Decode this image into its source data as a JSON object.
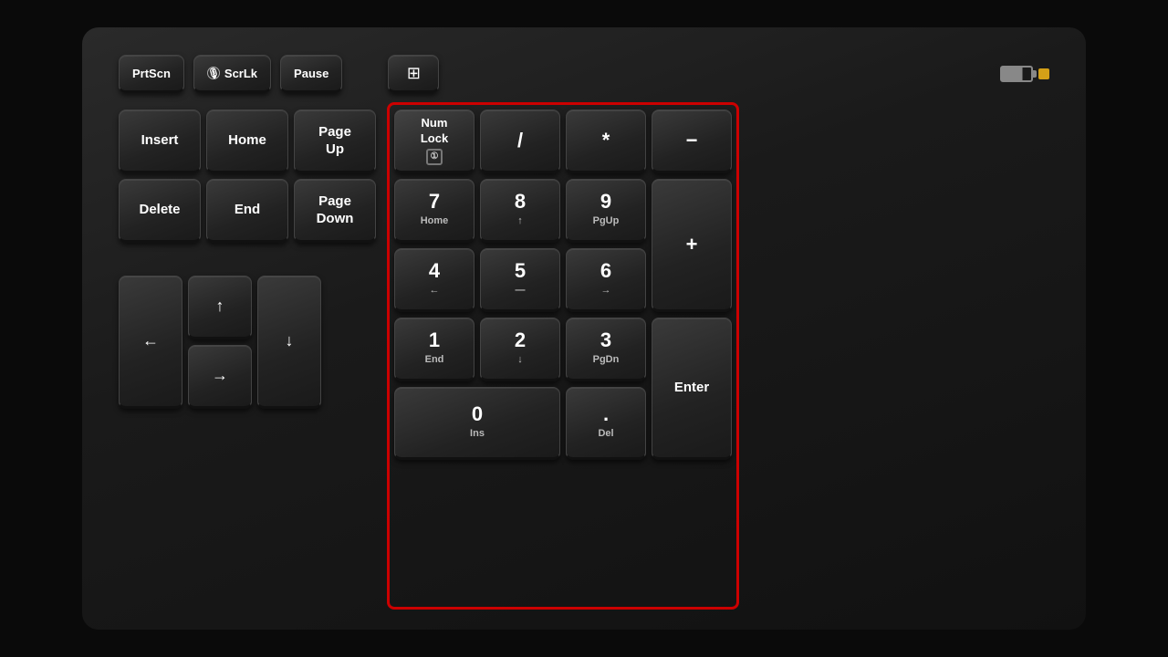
{
  "keyboard": {
    "top_keys": [
      {
        "id": "prtscn",
        "label": "PrtScn",
        "sub": null
      },
      {
        "id": "scrlk",
        "label": "ScrLk",
        "sub": null,
        "has_icon": true
      },
      {
        "id": "pause",
        "label": "Pause",
        "sub": null
      }
    ],
    "calculator_label": "🖩",
    "battery": {
      "level": "medium",
      "dot_color": "#d4a017"
    },
    "nav_keys": [
      {
        "id": "insert",
        "label": "Insert",
        "sub": null
      },
      {
        "id": "home",
        "label": "Home",
        "sub": null
      },
      {
        "id": "pageup",
        "label": "Page\nUp",
        "sub": null
      },
      {
        "id": "delete",
        "label": "Delete",
        "sub": null
      },
      {
        "id": "end",
        "label": "End",
        "sub": null
      },
      {
        "id": "pagedown",
        "label": "Page\nDown",
        "sub": null
      }
    ],
    "arrow_keys": [
      {
        "id": "left",
        "label": "←"
      },
      {
        "id": "up",
        "label": "↑"
      },
      {
        "id": "down",
        "label": "↓"
      },
      {
        "id": "right",
        "label": "→"
      }
    ],
    "numpad": {
      "highlighted": true,
      "keys": [
        {
          "id": "numlock",
          "main": "Num\nLock",
          "sub": "①",
          "special": "numlock"
        },
        {
          "id": "numdiv",
          "main": "/",
          "sub": null
        },
        {
          "id": "nummul",
          "main": "*",
          "sub": null
        },
        {
          "id": "numminus",
          "main": "−",
          "sub": null
        },
        {
          "id": "num7",
          "main": "7",
          "sub": "Home"
        },
        {
          "id": "num8",
          "main": "8",
          "sub": "↑"
        },
        {
          "id": "num9",
          "main": "9",
          "sub": "PgUp"
        },
        {
          "id": "numplus",
          "main": "+",
          "sub": null,
          "span": "row2"
        },
        {
          "id": "num4",
          "main": "4",
          "sub": "←"
        },
        {
          "id": "num5",
          "main": "5",
          "sub": "—"
        },
        {
          "id": "num6",
          "main": "6",
          "sub": "→"
        },
        {
          "id": "num1",
          "main": "1",
          "sub": "End"
        },
        {
          "id": "num2",
          "main": "2",
          "sub": "↓"
        },
        {
          "id": "num3",
          "main": "3",
          "sub": "PgDn"
        },
        {
          "id": "numenter",
          "main": "Enter",
          "sub": null,
          "span": "row2"
        },
        {
          "id": "num0",
          "main": "0",
          "sub": "Ins",
          "span": "col2"
        },
        {
          "id": "numdot",
          "main": ".",
          "sub": "Del"
        }
      ]
    }
  }
}
